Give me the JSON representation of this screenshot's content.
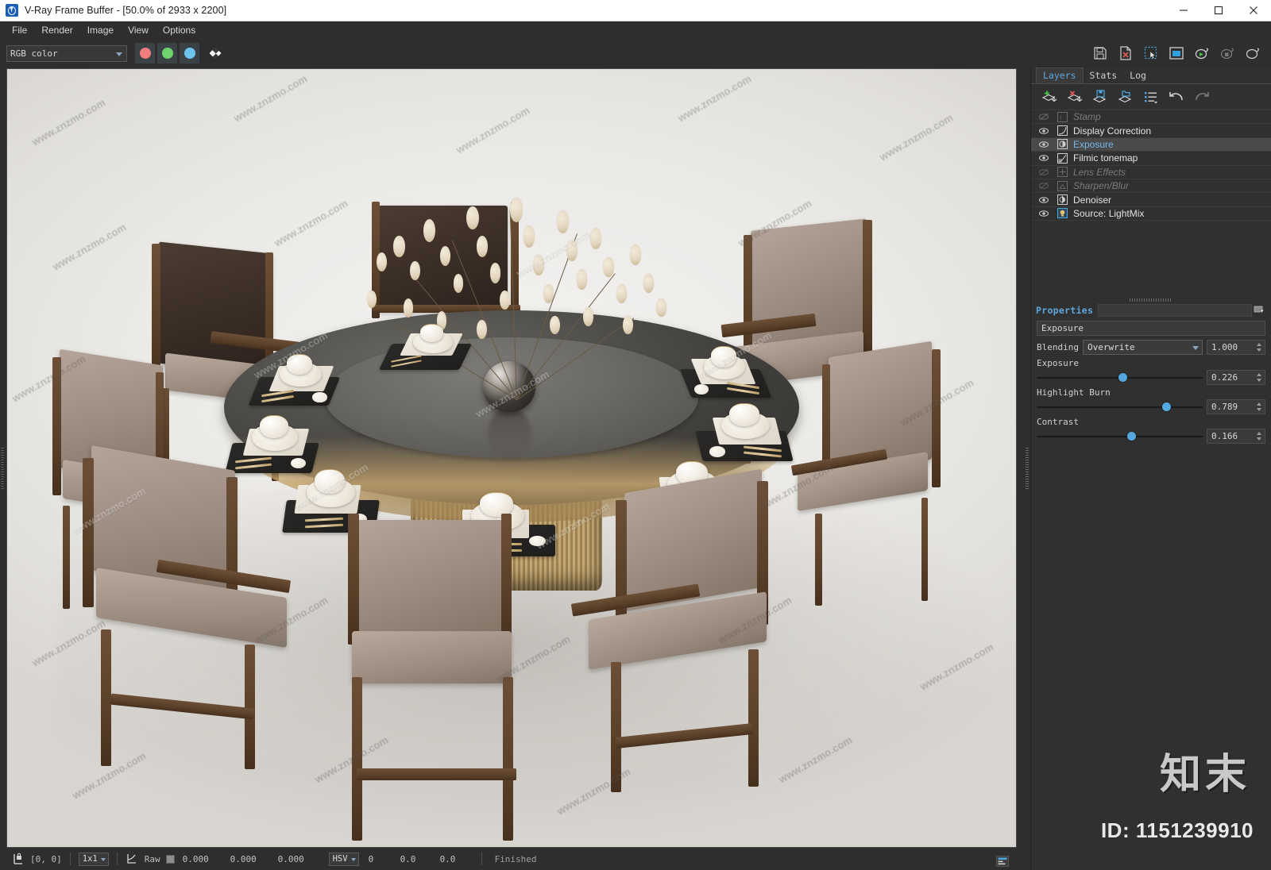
{
  "window": {
    "title": "V-Ray Frame Buffer - [50.0% of 2933 x 2200]",
    "icon": "vray-logo-icon",
    "minimize": "minimize-button",
    "maximize": "maximize-button",
    "close": "close-button"
  },
  "menu": {
    "items": [
      {
        "label": "File"
      },
      {
        "label": "Render"
      },
      {
        "label": "Image"
      },
      {
        "label": "View"
      },
      {
        "label": "Options"
      }
    ]
  },
  "toolbar": {
    "channel_select": {
      "value": "RGB color"
    },
    "channels": [
      {
        "name": "red-channel-button",
        "color": "#ef7d7d"
      },
      {
        "name": "green-channel-button",
        "color": "#6fd36f"
      },
      {
        "name": "blue-channel-button",
        "color": "#6fc4ef"
      }
    ],
    "alpha_button": "alpha-channel-button",
    "right_buttons": [
      {
        "name": "save-image-button",
        "icon": "floppy-save-icon"
      },
      {
        "name": "clear-image-button",
        "icon": "file-delete-icon"
      },
      {
        "name": "region-render-button",
        "icon": "marquee-select-icon"
      },
      {
        "name": "show-vfb-window-button",
        "icon": "window-icon"
      },
      {
        "name": "start-render-button",
        "icon": "teapot-play-icon"
      },
      {
        "name": "stop-render-button",
        "icon": "teapot-stop-icon"
      },
      {
        "name": "render-last-button",
        "icon": "teapot-icon"
      }
    ]
  },
  "statusbar": {
    "pixel_lock_icon": "pixel-lock-icon",
    "coords": "[0,  0]",
    "zoom_value": "1x1",
    "color_picker_icon": "color-corner-icon",
    "color_mode": "Raw",
    "swatch": "color-swatch",
    "rgb": [
      "0.000",
      "0.000",
      "0.000"
    ],
    "hsv_select": "HSV",
    "hsv_values": [
      "0",
      "0.0",
      "0.0"
    ],
    "render_status": "Finished",
    "panel_toggle_icon": "panel-toggle-icon"
  },
  "right_panel": {
    "tabs": [
      {
        "label": "Layers",
        "active": true
      },
      {
        "label": "Stats",
        "active": false
      },
      {
        "label": "Log",
        "active": false
      }
    ],
    "layer_toolbar": [
      {
        "name": "add-layer-button",
        "icon": "layer-plus-icon"
      },
      {
        "name": "delete-layer-button",
        "icon": "layer-x-icon"
      },
      {
        "name": "save-layers-button",
        "icon": "layer-save-icon"
      },
      {
        "name": "load-layers-button",
        "icon": "layer-open-icon"
      },
      {
        "name": "layer-presets-button",
        "icon": "list-menu-icon"
      },
      {
        "name": "undo-button",
        "icon": "undo-arrow-icon"
      },
      {
        "name": "redo-button",
        "icon": "redo-arrow-icon"
      }
    ],
    "layers": [
      {
        "name": "Stamp",
        "icon": "stamp-icon",
        "visible": false,
        "enabled": false,
        "selected": false
      },
      {
        "name": "Display Correction",
        "icon": "curve-icon",
        "visible": true,
        "enabled": true,
        "selected": false
      },
      {
        "name": "Exposure",
        "icon": "exposure-icon",
        "visible": true,
        "enabled": true,
        "selected": true
      },
      {
        "name": "Filmic tonemap",
        "icon": "filmic-icon",
        "visible": true,
        "enabled": true,
        "selected": false
      },
      {
        "name": "Lens Effects",
        "icon": "lens-effects-icon",
        "visible": false,
        "enabled": false,
        "selected": false
      },
      {
        "name": "Sharpen/Blur",
        "icon": "sharpen-blur-icon",
        "visible": false,
        "enabled": false,
        "selected": false
      },
      {
        "name": "Denoiser",
        "icon": "denoiser-icon",
        "visible": true,
        "enabled": true,
        "selected": false
      },
      {
        "name": "Source: LightMix",
        "icon": "lightmix-icon",
        "visible": true,
        "enabled": true,
        "selected": false
      }
    ],
    "properties": {
      "title": "Properties",
      "pin_icon": "pin-icon",
      "layer_name": "Exposure",
      "blending_label": "Blending",
      "blending_value": "Overwrite",
      "blending_amount": "1.000",
      "controls": [
        {
          "label": "Exposure",
          "value": "0.226",
          "percent": 52
        },
        {
          "label": "Highlight Burn",
          "value": "0.789",
          "percent": 78
        },
        {
          "label": "Contrast",
          "value": "0.166",
          "percent": 57
        }
      ]
    },
    "watermark_logo": "知末",
    "watermark_id": "ID: 1151239910"
  },
  "render_image": {
    "watermark_text": "www.znzmo.com",
    "description": "Round dark marble dining table with gold fluted base, eight leather-and-wood armchairs, place settings with cups and gold cutlery, and a dark glass vase with dried lunaria branches"
  },
  "colors": {
    "accent": "#5fa8dd",
    "panel_bg": "#303030",
    "chrome_bg": "#2e2e2e",
    "slider_knob": "#54a8dd"
  }
}
